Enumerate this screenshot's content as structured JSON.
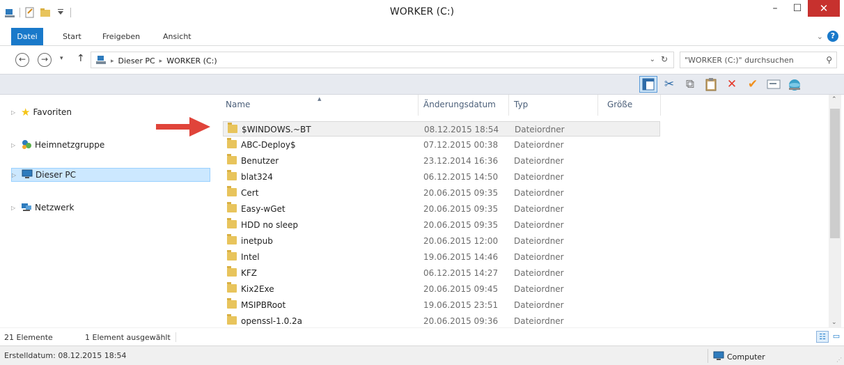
{
  "window": {
    "title": "WORKER (C:)",
    "minimize_glyph": "–",
    "maximize_glyph": "☐",
    "close_glyph": "✕"
  },
  "ribbon": {
    "tabs": [
      "Datei",
      "Start",
      "Freigeben",
      "Ansicht"
    ],
    "expand_glyph": "⌄",
    "help_glyph": "?"
  },
  "nav": {
    "back_glyph": "←",
    "forward_glyph": "→",
    "recent_glyph": "▾",
    "up_glyph": "↑",
    "breadcrumb": [
      "Dieser PC",
      "WORKER (C:)"
    ],
    "crumb_sep": "▸",
    "dropdown_glyph": "⌄",
    "refresh_glyph": "↻"
  },
  "search": {
    "placeholder": "\"WORKER (C:)\" durchsuchen",
    "icon_glyph": "⚲"
  },
  "toolbar": {
    "icons": [
      "preview-pane-icon",
      "cut-icon",
      "copy-icon",
      "paste-icon",
      "delete-icon",
      "checkmark-icon",
      "rename-icon",
      "network-globe-icon"
    ],
    "glyphs": {
      "cut": "✂",
      "copy": "⧉",
      "paste": "📋",
      "delete": "✕",
      "check": "✔",
      "rename": "▭",
      "globe": "◉"
    },
    "colors": {
      "delete": "#e53a2b",
      "check": "#f0901e",
      "globe": "#3aa0c8",
      "accent": "#1979ca"
    }
  },
  "navpane": {
    "items": [
      {
        "label": "Favoriten",
        "icon": "star-icon",
        "glyph": "★",
        "color": "#f5c518"
      },
      {
        "label": "Heimnetzgruppe",
        "icon": "homegroup-icon",
        "glyph": "❂",
        "color": "#2e7bbd"
      },
      {
        "label": "Dieser PC",
        "icon": "computer-icon",
        "glyph": "🖥",
        "color": "#2e7bbd"
      },
      {
        "label": "Netzwerk",
        "icon": "network-icon",
        "glyph": "⛓",
        "color": "#2e7bbd"
      }
    ],
    "expander_glyph": "▷"
  },
  "filelist": {
    "columns": [
      "Name",
      "Änderungsdatum",
      "Typ",
      "Größe"
    ],
    "sort_glyph": "▲",
    "rows": [
      {
        "name": "$WINDOWS.~BT",
        "date": "08.12.2015 18:54",
        "type": "Dateiordner"
      },
      {
        "name": "ABC-Deploy$",
        "date": "07.12.2015 00:38",
        "type": "Dateiordner"
      },
      {
        "name": "Benutzer",
        "date": "23.12.2014 16:36",
        "type": "Dateiordner"
      },
      {
        "name": "blat324",
        "date": "06.12.2015 14:50",
        "type": "Dateiordner"
      },
      {
        "name": "Cert",
        "date": "20.06.2015 09:35",
        "type": "Dateiordner"
      },
      {
        "name": "Easy-wGet",
        "date": "20.06.2015 09:35",
        "type": "Dateiordner"
      },
      {
        "name": "HDD no sleep",
        "date": "20.06.2015 09:35",
        "type": "Dateiordner"
      },
      {
        "name": "inetpub",
        "date": "20.06.2015 12:00",
        "type": "Dateiordner"
      },
      {
        "name": "Intel",
        "date": "19.06.2015 14:46",
        "type": "Dateiordner"
      },
      {
        "name": "KFZ",
        "date": "06.12.2015 14:27",
        "type": "Dateiordner"
      },
      {
        "name": "Kix2Exe",
        "date": "20.06.2015 09:45",
        "type": "Dateiordner"
      },
      {
        "name": "MSIPBRoot",
        "date": "19.06.2015 23:51",
        "type": "Dateiordner"
      },
      {
        "name": "openssl-1.0.2a",
        "date": "20.06.2015 09:36",
        "type": "Dateiordner"
      }
    ]
  },
  "scrollbar": {
    "up_glyph": "⌃",
    "down_glyph": "⌄"
  },
  "status": {
    "count": "21 Elemente",
    "selected": "1 Element ausgewählt",
    "created": "Erstelldatum: 08.12.2015 18:54",
    "computer": "Computer",
    "details_view_glyph": "☷",
    "tiles_view_glyph": "▭",
    "grip_glyph": "⋰"
  },
  "annotation": {
    "arrow_color": "#e0443a"
  }
}
